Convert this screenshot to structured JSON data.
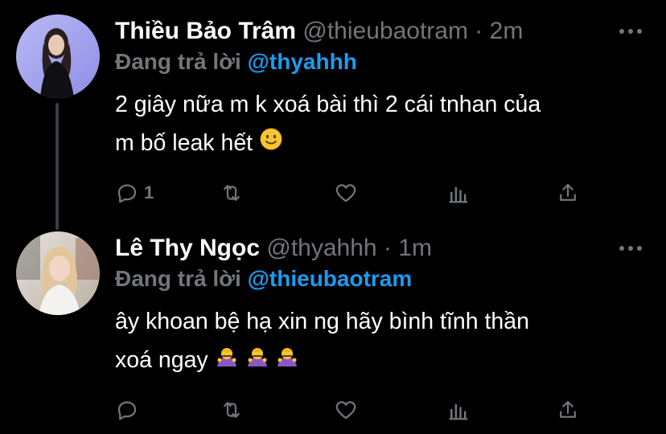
{
  "tweets": [
    {
      "name": "Thiều Bảo Trâm",
      "handle": "@thieubaotram",
      "separator": "·",
      "time": "2m",
      "replying_label": "Đang trả lời",
      "replying_to": "@thyahhh",
      "text_line1": "2 giây nữa m k xoá bài thì 2 cái tnhan của",
      "text_line2": "m bố leak hết",
      "emoji": "slightly-smiling-face",
      "reply_count": "1"
    },
    {
      "name": "Lê Thy Ngọc",
      "handle": "@thyahhh",
      "separator": "·",
      "time": "1m",
      "replying_label": "Đang trả lời",
      "replying_to": "@thieubaotram",
      "text_line1": "ây khoan bệ hạ xin ng hãy bình tĩnh thần",
      "text_line2": "xoá ngay",
      "emoji": "person-bowing",
      "reply_count": ""
    }
  ],
  "icons": [
    "reply-icon",
    "retweet-icon",
    "like-icon",
    "analytics-icon",
    "share-icon",
    "more-icon"
  ],
  "colors": {
    "background": "#000000",
    "muted": "#71767b",
    "accent": "#1d9bf0",
    "thread_line": "#3a3f45"
  }
}
